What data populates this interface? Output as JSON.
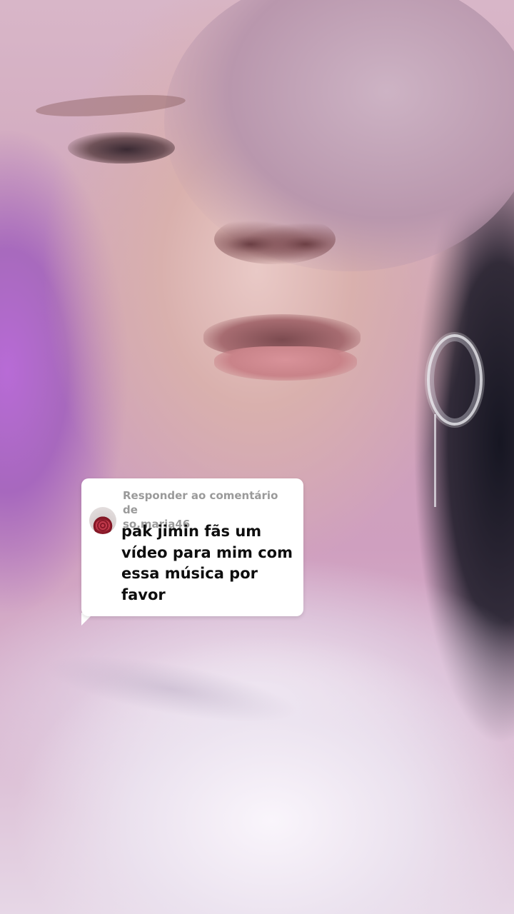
{
  "reply_sticker": {
    "header": "Responder ao comentário de",
    "username": "so.maria46",
    "comment": "pak jimin fãs um vídeo para mim com essa música por favor"
  }
}
